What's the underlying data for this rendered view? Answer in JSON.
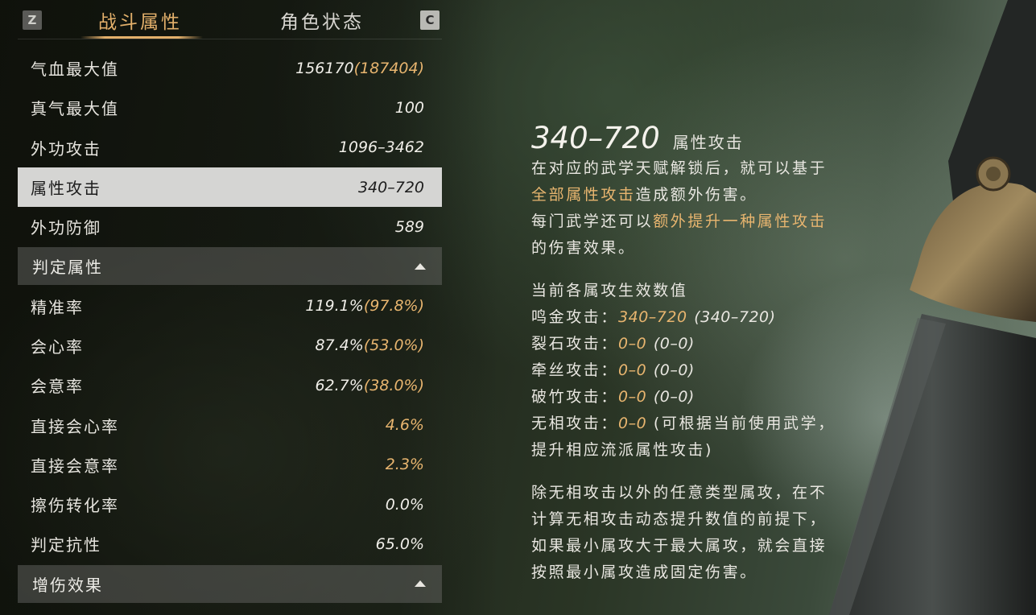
{
  "tabs": {
    "left_key": "Z",
    "right_key": "C",
    "active": "战斗属性",
    "inactive": "角色状态"
  },
  "stats_top": [
    {
      "label": "气血最大值",
      "value": "156170",
      "paren": "(187404)"
    },
    {
      "label": "真气最大值",
      "value": "100",
      "paren": ""
    },
    {
      "label": "外功攻击",
      "value": "1096–3462",
      "paren": ""
    },
    {
      "label": "属性攻击",
      "value": "340–720",
      "paren": ""
    },
    {
      "label": "外功防御",
      "value": "589",
      "paren": ""
    }
  ],
  "section_judge": "判定属性",
  "stats_judge": [
    {
      "label": "精准率",
      "value": "119.1%",
      "paren": "(97.8%)"
    },
    {
      "label": "会心率",
      "value": "87.4%",
      "paren": "(53.0%)"
    },
    {
      "label": "会意率",
      "value": "62.7%",
      "paren": "(38.0%)"
    },
    {
      "label": "直接会心率",
      "value": "4.6%",
      "paren": ""
    },
    {
      "label": "直接会意率",
      "value": "2.3%",
      "paren": ""
    },
    {
      "label": "擦伤转化率",
      "value": "0.0%",
      "paren": ""
    },
    {
      "label": "判定抗性",
      "value": "65.0%",
      "paren": ""
    }
  ],
  "section_damage": "增伤效果",
  "detail": {
    "big_value": "340–720",
    "title": "属性攻击",
    "p1_l1": "在对应的武学天赋解锁后，就可以基于",
    "p1_l2_gold": "全部属性攻击",
    "p1_l2_rest": "造成额外伤害。",
    "p1_l3_a": "每门武学还可以",
    "p1_l3_gold": "额外提升一种属性攻击",
    "p1_l4": "的伤害效果。",
    "sub_title": "当前各属攻生效数值",
    "elements": [
      {
        "name": "鸣金攻击：",
        "value": "340–720",
        "paren": "(340–720)"
      },
      {
        "name": "裂石攻击：",
        "value": "0–0",
        "paren": "(0–0)"
      },
      {
        "name": "牵丝攻击：",
        "value": "0–0",
        "paren": "(0–0)"
      },
      {
        "name": "破竹攻击：",
        "value": "0–0",
        "paren": "(0–0)"
      },
      {
        "name": "无相攻击：",
        "value": "0–0",
        "paren": "(可根据当前使用武学，"
      }
    ],
    "wuxiang_cont": "提升相应流派属性攻击)",
    "p3_l1": "除无相攻击以外的任意类型属攻，在不",
    "p3_l2": "计算无相攻击动态提升数值的前提下，",
    "p3_l3_gold": "如果最小属攻大于最大属攻，就会直接",
    "p3_l4_gold": "按照最小属攻造成固定伤害。"
  },
  "colors": {
    "gold": "#e8b56f",
    "selected_bg": "#d5d5d3",
    "section_bg": "#5e5e5c"
  }
}
